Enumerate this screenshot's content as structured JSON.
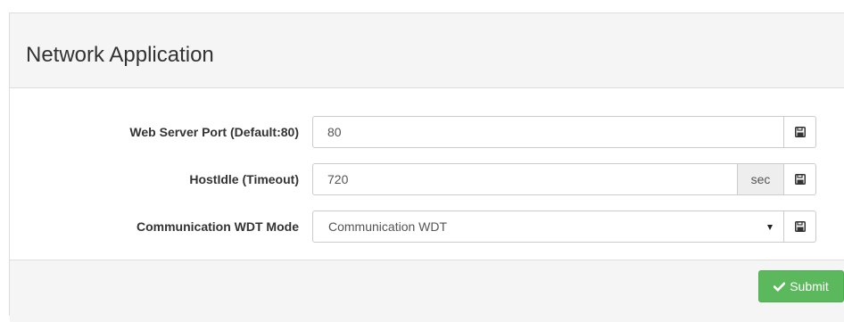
{
  "panel": {
    "title": "Network Application"
  },
  "fields": {
    "web_server_port": {
      "label": "Web Server Port (Default:80)",
      "value": "80",
      "save_icon": "floppy-disk-icon"
    },
    "host_idle": {
      "label": "HostIdle (Timeout)",
      "value": "720",
      "unit": "sec",
      "save_icon": "floppy-disk-icon"
    },
    "comm_wdt_mode": {
      "label": "Communication WDT Mode",
      "selected": "Communication WDT",
      "save_icon": "floppy-disk-icon"
    }
  },
  "footer": {
    "submit_label": "Submit",
    "submit_icon": "checkmark-icon"
  },
  "colors": {
    "submit_bg": "#5cb85c",
    "header_bg": "#f5f5f5",
    "border": "#dddddd"
  }
}
